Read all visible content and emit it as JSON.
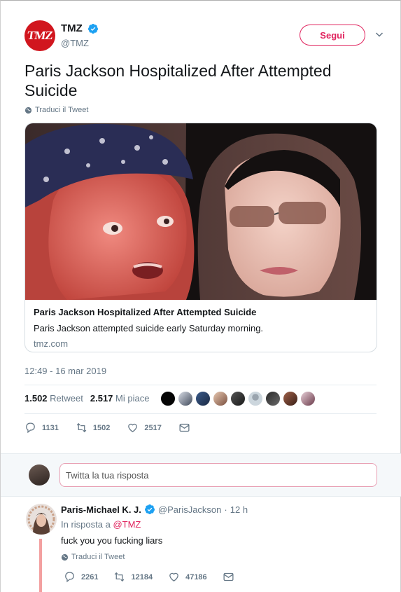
{
  "author": {
    "logo_text": "TMZ",
    "display_name": "TMZ",
    "handle": "@TMZ",
    "follow_label": "Segui"
  },
  "tweet": {
    "text": "Paris Jackson Hospitalized After Attempted Suicide",
    "translate_label": "Traduci il Tweet",
    "timestamp": "12:49 - 16 mar 2019"
  },
  "card": {
    "title": "Paris Jackson Hospitalized After Attempted Suicide",
    "description": "Paris Jackson attempted suicide early Saturday morning.",
    "domain": "tmz.com"
  },
  "stats": {
    "retweet_count": "1.502",
    "retweet_label": "Retweet",
    "like_count": "2.517",
    "like_label": "Mi piace"
  },
  "actions": {
    "reply_count": "1131",
    "retweet_count": "1502",
    "like_count": "2517"
  },
  "reply_box": {
    "placeholder": "Twitta la tua risposta"
  },
  "reply": {
    "display_name": "Paris-Michael K. J.",
    "handle": "@ParisJackson",
    "separator": "·",
    "time": "12 h",
    "in_reply_prefix": "In risposta a",
    "in_reply_mention": "@TMZ",
    "text": "fuck you you fucking liars",
    "translate_label": "Traduci il Tweet",
    "reply_count": "2261",
    "retweet_count": "12184",
    "like_count": "47186"
  },
  "colors": {
    "brand": "#d1161e",
    "accent": "#e0245e",
    "verified": "#1da1f2",
    "muted": "#657786"
  }
}
